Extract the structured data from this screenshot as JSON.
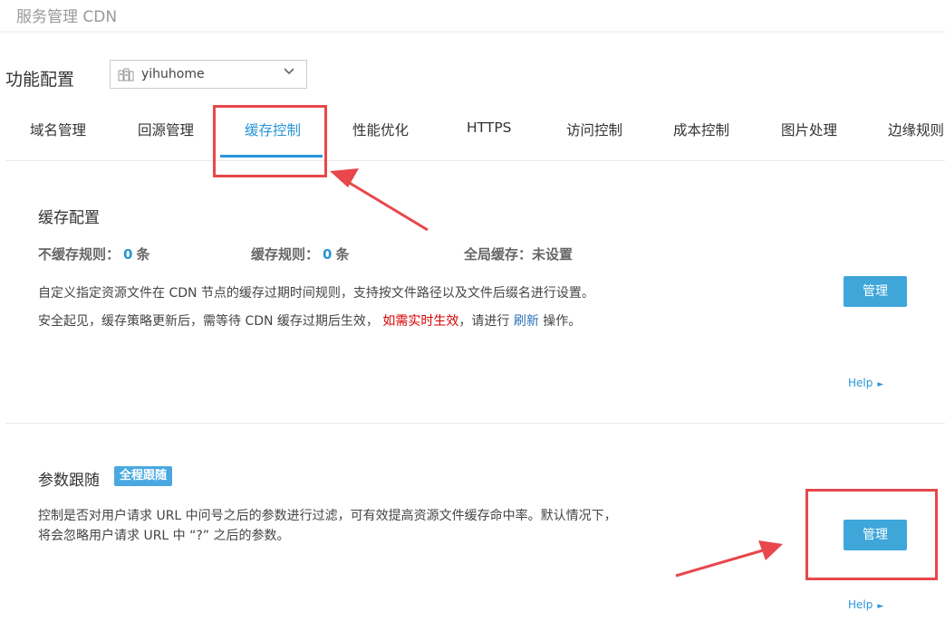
{
  "header": {
    "title": "服务管理 CDN"
  },
  "config": {
    "label": "功能配置",
    "domain": "yihuhome"
  },
  "tabs": [
    {
      "label": "域名管理"
    },
    {
      "label": "回源管理"
    },
    {
      "label": "缓存控制",
      "active": true
    },
    {
      "label": "性能优化"
    },
    {
      "label": "HTTPS"
    },
    {
      "label": "访问控制"
    },
    {
      "label": "成本控制"
    },
    {
      "label": "图片处理"
    },
    {
      "label": "边缘规则"
    }
  ],
  "cache": {
    "title": "缓存配置",
    "no_cache_label": "不缓存规则：",
    "no_cache_count": "0",
    "cache_rule_label": "缓存规则：",
    "cache_rule_count": "0",
    "count_unit": "条",
    "global_label": "全局缓存：",
    "global_value": "未设置",
    "desc1": "自定义指定资源文件在 CDN 节点的缓存过期时间规则，支持按文件路径以及文件后缀名进行设置。",
    "desc2_part1": "安全起见，缓存策略更新后，需等待 CDN 缓存过期后生效，",
    "desc2_red": "如需实时生效",
    "desc2_part2": "，请进行",
    "desc2_link": "刷新",
    "desc2_part3": "操作。",
    "manage_button": "管理",
    "help": "Help",
    "help_arrow": "►"
  },
  "param": {
    "title": "参数跟随",
    "badge": "全程跟随",
    "desc1": "控制是否对用户请求 URL 中问号之后的参数进行过滤，可有效提高资源文件缓存命中率。默认情况下，",
    "desc2": "将会忽略用户请求 URL 中 “?” 之后的参数。",
    "manage_button": "管理",
    "help": "Help",
    "help_arrow": "►"
  },
  "colors": {
    "accent": "#2a95d8",
    "button": "#3fa6da",
    "annotation": "#e8474b",
    "warning_text": "#d60000"
  }
}
